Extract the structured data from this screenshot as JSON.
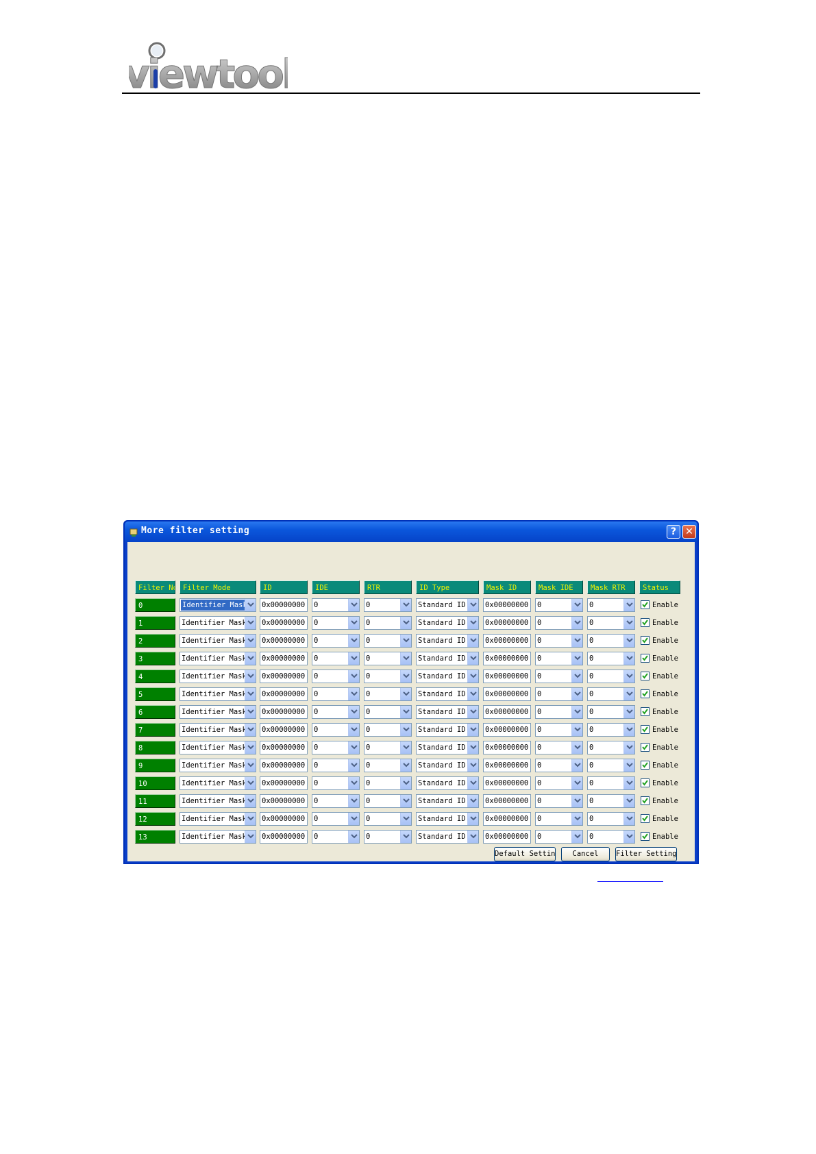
{
  "logo": {
    "text": "viewtool"
  },
  "dialog": {
    "title": "More filter setting",
    "help_label": "?",
    "close_label": "✕",
    "icon": "filter-app-icon",
    "columns": [
      "Filter No",
      "Filter Mode",
      "ID",
      "IDE",
      "RTR",
      "ID Type",
      "Mask ID",
      "Mask IDE",
      "Mask RTR",
      "Status"
    ],
    "rows": [
      {
        "no": "0",
        "mode": "Identifier Mask",
        "id": "0x00000000",
        "ide": "0",
        "rtr": "0",
        "id_type": "Standard ID",
        "mask_id": "0x00000000",
        "mask_ide": "0",
        "mask_rtr": "0",
        "status": "Enable",
        "checked": true
      },
      {
        "no": "1",
        "mode": "Identifier Mask",
        "id": "0x00000000",
        "ide": "0",
        "rtr": "0",
        "id_type": "Standard ID",
        "mask_id": "0x00000000",
        "mask_ide": "0",
        "mask_rtr": "0",
        "status": "Enable",
        "checked": true
      },
      {
        "no": "2",
        "mode": "Identifier Mask",
        "id": "0x00000000",
        "ide": "0",
        "rtr": "0",
        "id_type": "Standard ID",
        "mask_id": "0x00000000",
        "mask_ide": "0",
        "mask_rtr": "0",
        "status": "Enable",
        "checked": true
      },
      {
        "no": "3",
        "mode": "Identifier Mask",
        "id": "0x00000000",
        "ide": "0",
        "rtr": "0",
        "id_type": "Standard ID",
        "mask_id": "0x00000000",
        "mask_ide": "0",
        "mask_rtr": "0",
        "status": "Enable",
        "checked": true
      },
      {
        "no": "4",
        "mode": "Identifier Mask",
        "id": "0x00000000",
        "ide": "0",
        "rtr": "0",
        "id_type": "Standard ID",
        "mask_id": "0x00000000",
        "mask_ide": "0",
        "mask_rtr": "0",
        "status": "Enable",
        "checked": true
      },
      {
        "no": "5",
        "mode": "Identifier Mask",
        "id": "0x00000000",
        "ide": "0",
        "rtr": "0",
        "id_type": "Standard ID",
        "mask_id": "0x00000000",
        "mask_ide": "0",
        "mask_rtr": "0",
        "status": "Enable",
        "checked": true
      },
      {
        "no": "6",
        "mode": "Identifier Mask",
        "id": "0x00000000",
        "ide": "0",
        "rtr": "0",
        "id_type": "Standard ID",
        "mask_id": "0x00000000",
        "mask_ide": "0",
        "mask_rtr": "0",
        "status": "Enable",
        "checked": true
      },
      {
        "no": "7",
        "mode": "Identifier Mask",
        "id": "0x00000000",
        "ide": "0",
        "rtr": "0",
        "id_type": "Standard ID",
        "mask_id": "0x00000000",
        "mask_ide": "0",
        "mask_rtr": "0",
        "status": "Enable",
        "checked": true
      },
      {
        "no": "8",
        "mode": "Identifier Mask",
        "id": "0x00000000",
        "ide": "0",
        "rtr": "0",
        "id_type": "Standard ID",
        "mask_id": "0x00000000",
        "mask_ide": "0",
        "mask_rtr": "0",
        "status": "Enable",
        "checked": true
      },
      {
        "no": "9",
        "mode": "Identifier Mask",
        "id": "0x00000000",
        "ide": "0",
        "rtr": "0",
        "id_type": "Standard ID",
        "mask_id": "0x00000000",
        "mask_ide": "0",
        "mask_rtr": "0",
        "status": "Enable",
        "checked": true
      },
      {
        "no": "10",
        "mode": "Identifier Mask",
        "id": "0x00000000",
        "ide": "0",
        "rtr": "0",
        "id_type": "Standard ID",
        "mask_id": "0x00000000",
        "mask_ide": "0",
        "mask_rtr": "0",
        "status": "Enable",
        "checked": true
      },
      {
        "no": "11",
        "mode": "Identifier Mask",
        "id": "0x00000000",
        "ide": "0",
        "rtr": "0",
        "id_type": "Standard ID",
        "mask_id": "0x00000000",
        "mask_ide": "0",
        "mask_rtr": "0",
        "status": "Enable",
        "checked": true
      },
      {
        "no": "12",
        "mode": "Identifier Mask",
        "id": "0x00000000",
        "ide": "0",
        "rtr": "0",
        "id_type": "Standard ID",
        "mask_id": "0x00000000",
        "mask_ide": "0",
        "mask_rtr": "0",
        "status": "Enable",
        "checked": true
      },
      {
        "no": "13",
        "mode": "Identifier Mask",
        "id": "0x00000000",
        "ide": "0",
        "rtr": "0",
        "id_type": "Standard ID",
        "mask_id": "0x00000000",
        "mask_ide": "0",
        "mask_rtr": "0",
        "status": "Enable",
        "checked": true
      }
    ],
    "buttons": {
      "default": "Default Setting",
      "cancel": "Cancel",
      "filter": "Filter Setting"
    }
  },
  "colors": {
    "header_bg": "#0a8a7a",
    "header_text": "#f4f400",
    "row_no_bg": "#008000",
    "titlebar": "#0b57dc"
  }
}
